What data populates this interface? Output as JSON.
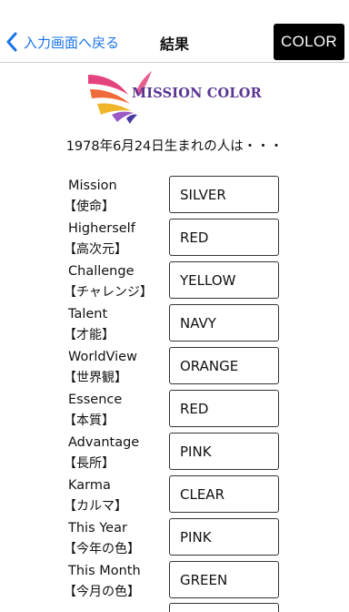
{
  "nav": {
    "back_label": "入力画面へ戻る",
    "title": "結果",
    "color_button_label": "COLOR",
    "back_color": "#1a73e8"
  },
  "logo": {
    "text": "MISSION COLOR",
    "text_color": "#5a3591"
  },
  "intro_text": "1978年6月24日生まれの人は・・・",
  "results": [
    {
      "label_en": "Mission",
      "label_ja": "【使命】",
      "value": "SILVER"
    },
    {
      "label_en": "Higherself",
      "label_ja": "【高次元】",
      "value": "RED"
    },
    {
      "label_en": "Challenge",
      "label_ja": "【チャレンジ】",
      "value": "YELLOW"
    },
    {
      "label_en": "Talent",
      "label_ja": "【才能】",
      "value": "NAVY"
    },
    {
      "label_en": "WorldView",
      "label_ja": "【世界観】",
      "value": "ORANGE"
    },
    {
      "label_en": "Essence",
      "label_ja": "【本質】",
      "value": "RED"
    },
    {
      "label_en": "Advantage",
      "label_ja": "【長所】",
      "value": "PINK"
    },
    {
      "label_en": "Karma",
      "label_ja": "【カルマ】",
      "value": "CLEAR"
    },
    {
      "label_en": "This Year",
      "label_ja": "【今年の色】",
      "value": "PINK"
    },
    {
      "label_en": "This Month",
      "label_ja": "【今月の色】",
      "value": "GREEN"
    }
  ]
}
